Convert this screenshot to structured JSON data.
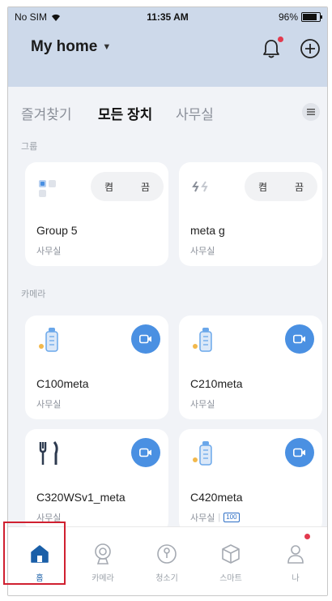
{
  "status_bar": {
    "carrier": "No SIM",
    "time": "11:35 AM",
    "battery": "96%",
    "battery_level": 0.96
  },
  "header": {
    "home_name": "My home"
  },
  "tabs": [
    {
      "label": "즐겨찾기",
      "active": false
    },
    {
      "label": "모든 장치",
      "active": true
    },
    {
      "label": "사무실",
      "active": false
    }
  ],
  "sections": {
    "groups": "그룹",
    "cameras": "카메라"
  },
  "groups": [
    {
      "name": "Group 5",
      "room": "사무실",
      "on_label": "켬",
      "off_label": "끔"
    },
    {
      "name": "meta g",
      "room": "사무실",
      "on_label": "켬",
      "off_label": "끔"
    }
  ],
  "cameras": [
    {
      "name": "C100meta",
      "room": "사무실",
      "icon": "bottle-icon"
    },
    {
      "name": "C210meta",
      "room": "사무실",
      "icon": "bottle-icon"
    },
    {
      "name": "C320WSv1_meta",
      "room": "사무실",
      "icon": "fork-knife-icon"
    },
    {
      "name": "C420meta",
      "room": "사무실",
      "badge": "100",
      "icon": "bottle-icon"
    }
  ],
  "bottom_nav": [
    {
      "label": "홈",
      "icon": "home-icon",
      "active": true
    },
    {
      "label": "카메라",
      "icon": "camera-icon",
      "active": false
    },
    {
      "label": "청소기",
      "icon": "vacuum-icon",
      "active": false
    },
    {
      "label": "스마트",
      "icon": "cube-icon",
      "active": false
    },
    {
      "label": "나",
      "icon": "person-icon",
      "active": false
    }
  ],
  "colors": {
    "accent": "#4a90e2",
    "header_bg": "#cdd9ea",
    "highlight": "#d02030",
    "notification": "#e23a4e"
  }
}
